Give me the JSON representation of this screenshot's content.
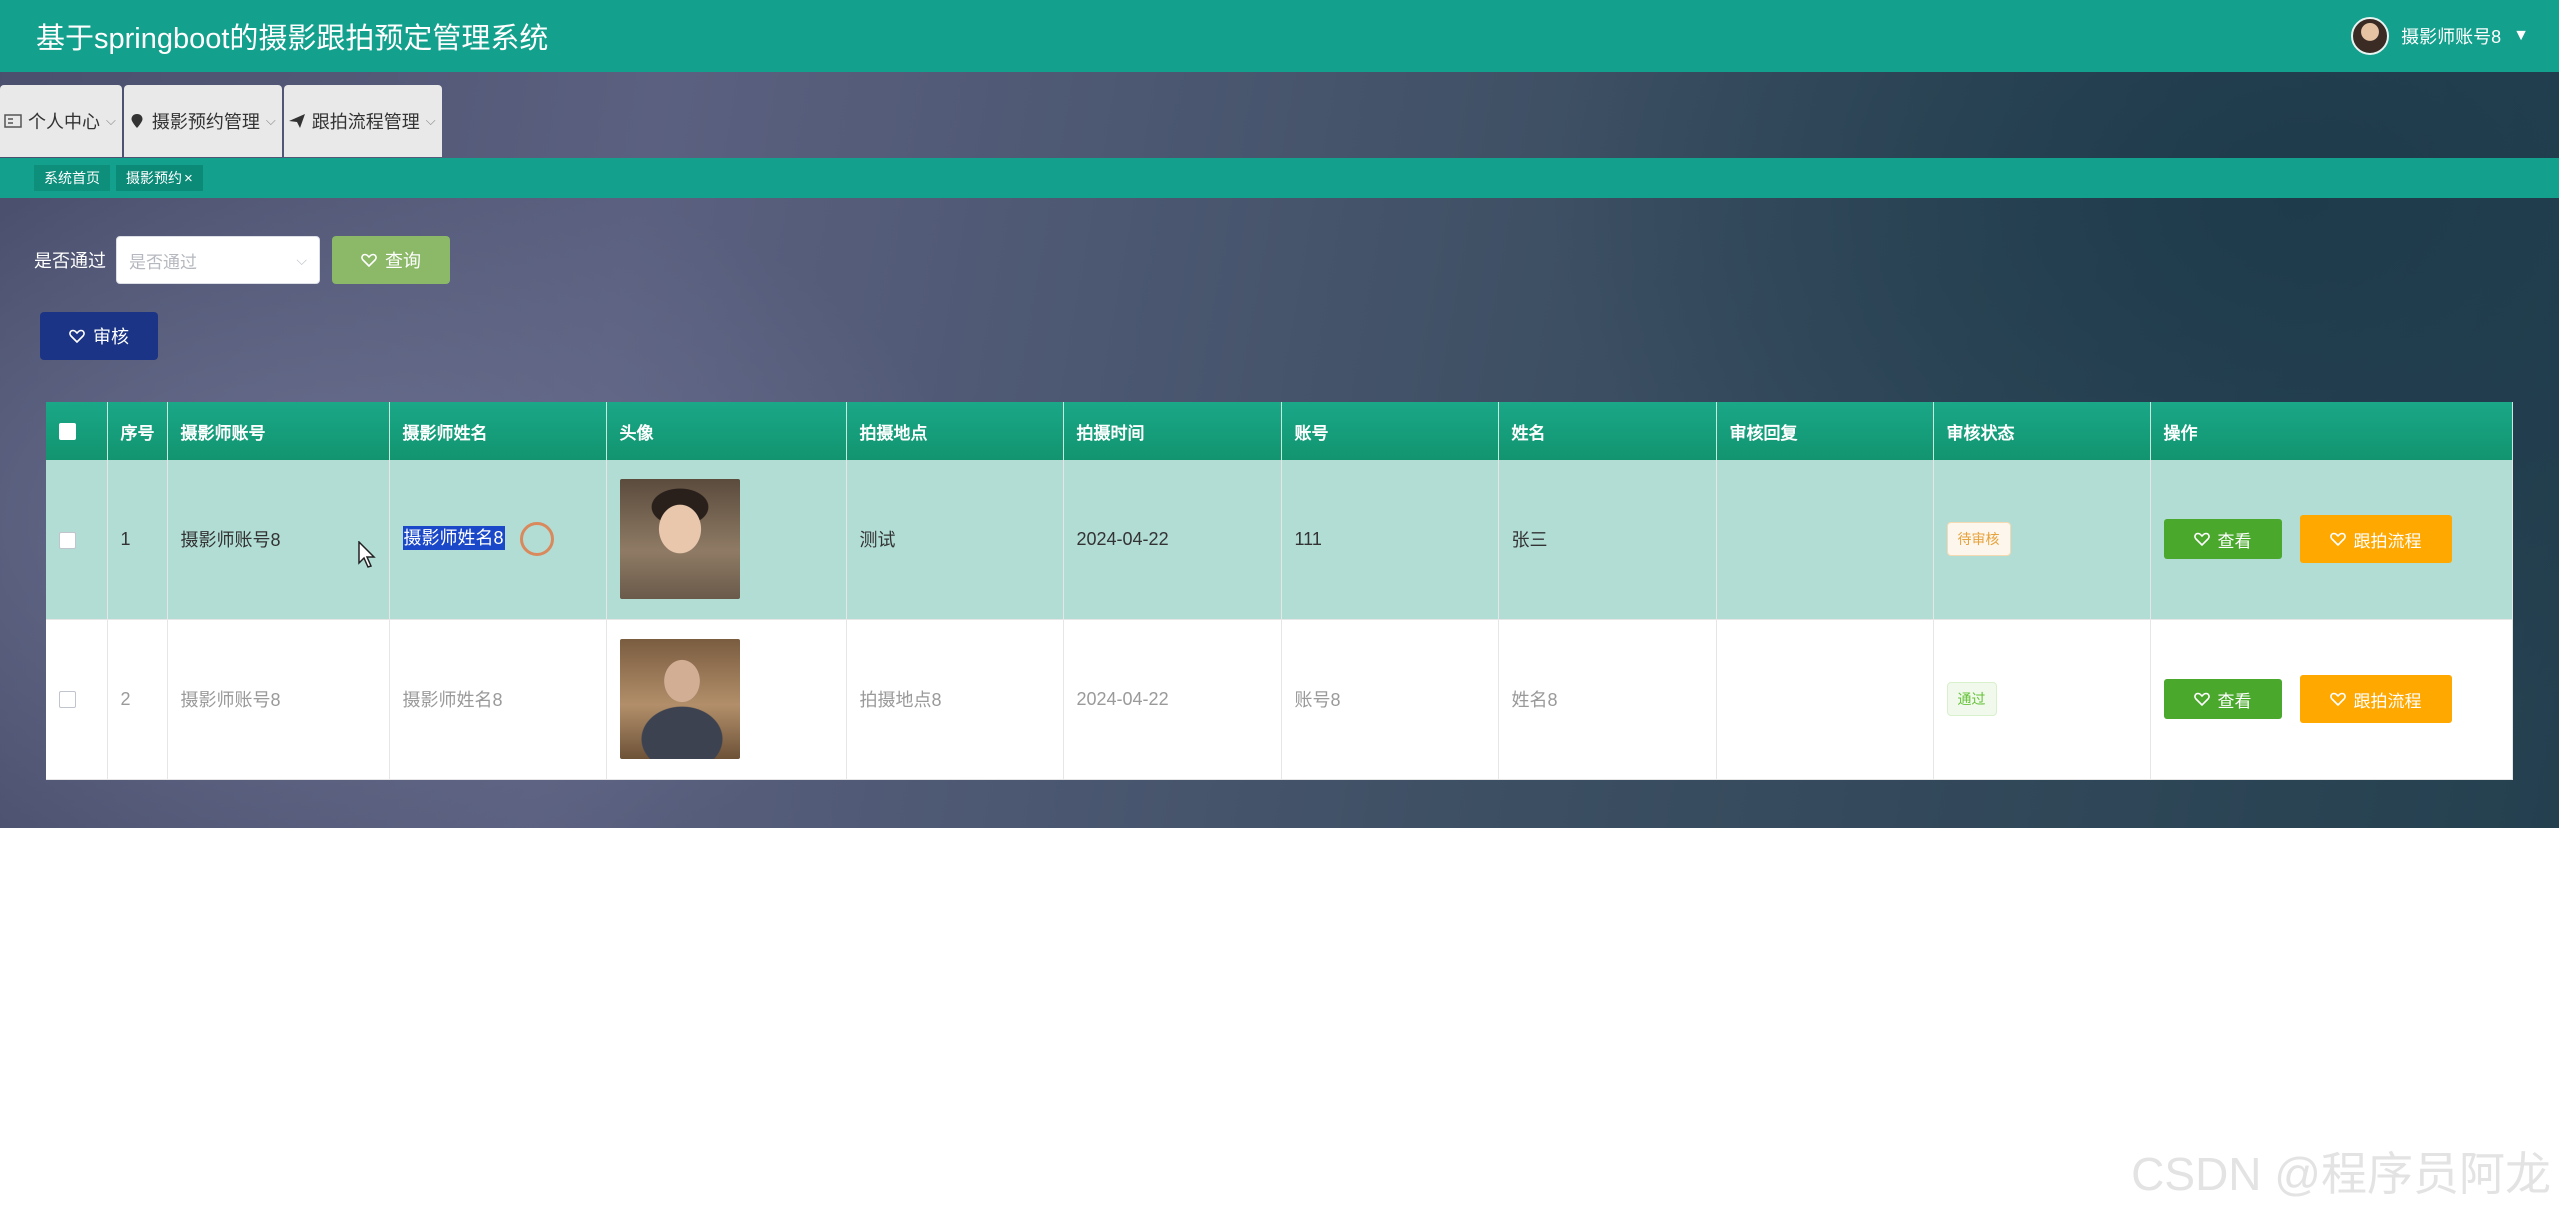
{
  "header": {
    "app_title": "基于springboot的摄影跟拍预定管理系统",
    "user_name": "摄影师账号8"
  },
  "menu": [
    {
      "label": "个人中心",
      "icon": "id-card-icon"
    },
    {
      "label": "摄影预约管理",
      "icon": "pin-icon"
    },
    {
      "label": "跟拍流程管理",
      "icon": "paper-plane-icon"
    }
  ],
  "tabs": {
    "home": "系统首页",
    "current": "摄影预约"
  },
  "search": {
    "label": "是否通过",
    "placeholder": "是否通过",
    "query_button": "查询"
  },
  "audit_button": "审核",
  "table": {
    "columns": [
      "序号",
      "摄影师账号",
      "摄影师姓名",
      "头像",
      "拍摄地点",
      "拍摄时间",
      "账号",
      "姓名",
      "审核回复",
      "审核状态",
      "操作"
    ],
    "rows": [
      {
        "index": "1",
        "photographer_account": "摄影师账号8",
        "photographer_name": "摄影师姓名8",
        "location": "测试",
        "time": "2024-04-22",
        "account": "111",
        "name": "张三",
        "reply": "",
        "status": "待审核",
        "view": "查看",
        "flow": "跟拍流程"
      },
      {
        "index": "2",
        "photographer_account": "摄影师账号8",
        "photographer_name": "摄影师姓名8",
        "location": "拍摄地点8",
        "time": "2024-04-22",
        "account": "账号8",
        "name": "姓名8",
        "reply": "",
        "status": "通过",
        "view": "查看",
        "flow": "跟拍流程"
      }
    ]
  },
  "colors": {
    "header": "#13a08c",
    "query_button": "#8bb967",
    "audit_button": "#1b3486",
    "view_button": "#4aa82c",
    "flow_button": "#ffa800"
  },
  "watermark": "CSDN @程序员阿龙"
}
